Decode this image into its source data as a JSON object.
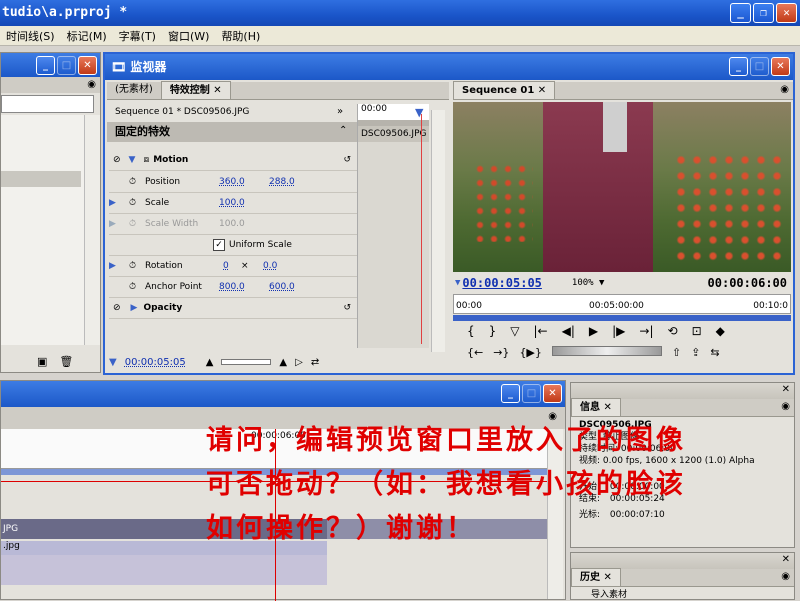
{
  "app": {
    "title": "tudio\\a.prproj *",
    "window_buttons": [
      "_",
      "❐",
      "✕"
    ]
  },
  "menu": [
    "时间线(S)",
    "标记(M)",
    "字幕(T)",
    "窗口(W)",
    "帮助(H)"
  ],
  "monitor": {
    "title": "监视器",
    "tabs": {
      "source": "(无素材)",
      "effects": "特效控制",
      "program": "Sequence 01"
    },
    "clip_path": "Sequence 01 * DSC09506.JPG",
    "clip_name": "DSC09506.JPG",
    "timeline_time": "00:00",
    "fixed_effects": "固定的特效",
    "motion_label": "Motion",
    "rows": [
      {
        "label": "Position",
        "v1": "360.0",
        "v2": "288.0"
      },
      {
        "label": "Scale",
        "v1": "100.0"
      },
      {
        "label": "Scale Width",
        "v1": "100.0"
      },
      {
        "label": "Uniform Scale"
      },
      {
        "label": "Rotation",
        "v1": "0",
        "x": "×",
        "v2": "0.0"
      },
      {
        "label": "Anchor Point",
        "v1": "800.0",
        "v2": "600.0"
      }
    ],
    "opacity_label": "Opacity",
    "ec_time": "00:00:05:05",
    "program_time": "00:00:05:05",
    "zoom": "100%",
    "duration": "00:00:06:00",
    "ruler": [
      "00:00",
      "00:05:00:00",
      "00:10:0"
    ]
  },
  "info": {
    "tab": "信息",
    "file": "DSC09506.JPG",
    "type": "类型: 静止图像",
    "duration": "持续时间: 00:00:06:00",
    "video": "视频: 0.00 fps, 1600 x 1200 (1.0) Alpha",
    "start_label": "开始:",
    "start": "00:00:00:00",
    "end_label": "结束:",
    "end": "00:00:05:24",
    "cursor_label": "光标:",
    "cursor": "00:00:07:10"
  },
  "history": {
    "tab": "历史",
    "item": "导入素材"
  },
  "timeline": {
    "clip1": "JPG",
    "clip2": ".jpg",
    "playhead": "00:00:06:00"
  },
  "overlay": {
    "line1": "请问，编辑预览窗口里放入了的图像",
    "line2": "可否拖动？（如：我想看小孩的脸该",
    "line3": "如何操作？）谢谢！"
  }
}
